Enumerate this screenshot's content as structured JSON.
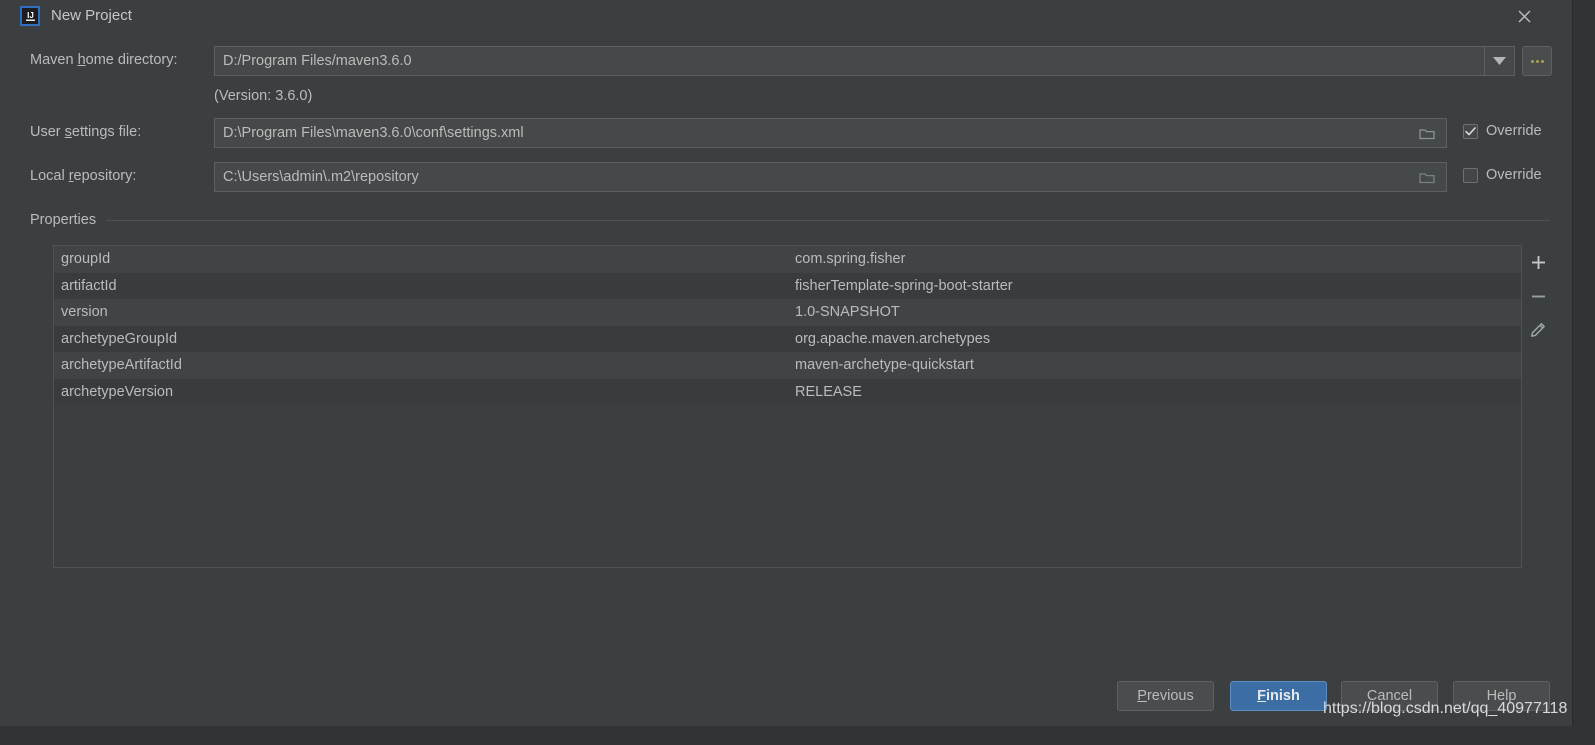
{
  "window": {
    "title": "New Project",
    "app_icon": "intellij-idea-icon",
    "close_icon": "close-icon"
  },
  "form": {
    "maven_home": {
      "label_prefix": "Maven ",
      "label_mnemonic": "h",
      "label_suffix": "ome directory:",
      "value": "D:/Program Files/maven3.6.0",
      "dropdown_icon": "chevron-down-icon",
      "browse_label": "..."
    },
    "version_note": "(Version: 3.6.0)",
    "user_settings": {
      "label_prefix": "User ",
      "label_mnemonic": "s",
      "label_suffix": "ettings file:",
      "value": "D:\\Program Files\\maven3.6.0\\conf\\settings.xml",
      "folder_icon": "folder-icon",
      "override_label": "Override",
      "override_checked": true
    },
    "local_repository": {
      "label_prefix": "Local ",
      "label_mnemonic": "r",
      "label_suffix": "epository:",
      "value": "C:\\Users\\admin\\.m2\\repository",
      "folder_icon": "folder-icon",
      "override_label": "Override",
      "override_checked": false
    }
  },
  "properties": {
    "section_title": "Properties",
    "rows": [
      {
        "key": "groupId",
        "value": "com.spring.fisher"
      },
      {
        "key": "artifactId",
        "value": "fisherTemplate-spring-boot-starter"
      },
      {
        "key": "version",
        "value": "1.0-SNAPSHOT"
      },
      {
        "key": "archetypeGroupId",
        "value": "org.apache.maven.archetypes"
      },
      {
        "key": "archetypeArtifactId",
        "value": "maven-archetype-quickstart"
      },
      {
        "key": "archetypeVersion",
        "value": "RELEASE"
      }
    ],
    "toolbar": [
      {
        "name": "add-property-button",
        "icon": "plus-icon"
      },
      {
        "name": "remove-property-button",
        "icon": "minus-icon"
      },
      {
        "name": "edit-property-button",
        "icon": "pencil-icon"
      }
    ]
  },
  "buttons": {
    "previous": {
      "prefix": "",
      "mnemonic": "P",
      "suffix": "revious"
    },
    "finish": {
      "prefix": "",
      "mnemonic": "F",
      "suffix": "inish"
    },
    "cancel": {
      "label": "Cancel"
    },
    "help": {
      "label": "Help"
    }
  },
  "watermark": "https://blog.csdn.net/qq_40977118",
  "colors": {
    "dialog_bg": "#3c3f41",
    "field_bg": "#45494a",
    "text": "#bbbbbb",
    "accent_blue": "#3c6ea5",
    "icon_border_blue": "#2f6ec0",
    "row_odd": "#414447",
    "row_even": "#393c3f"
  }
}
